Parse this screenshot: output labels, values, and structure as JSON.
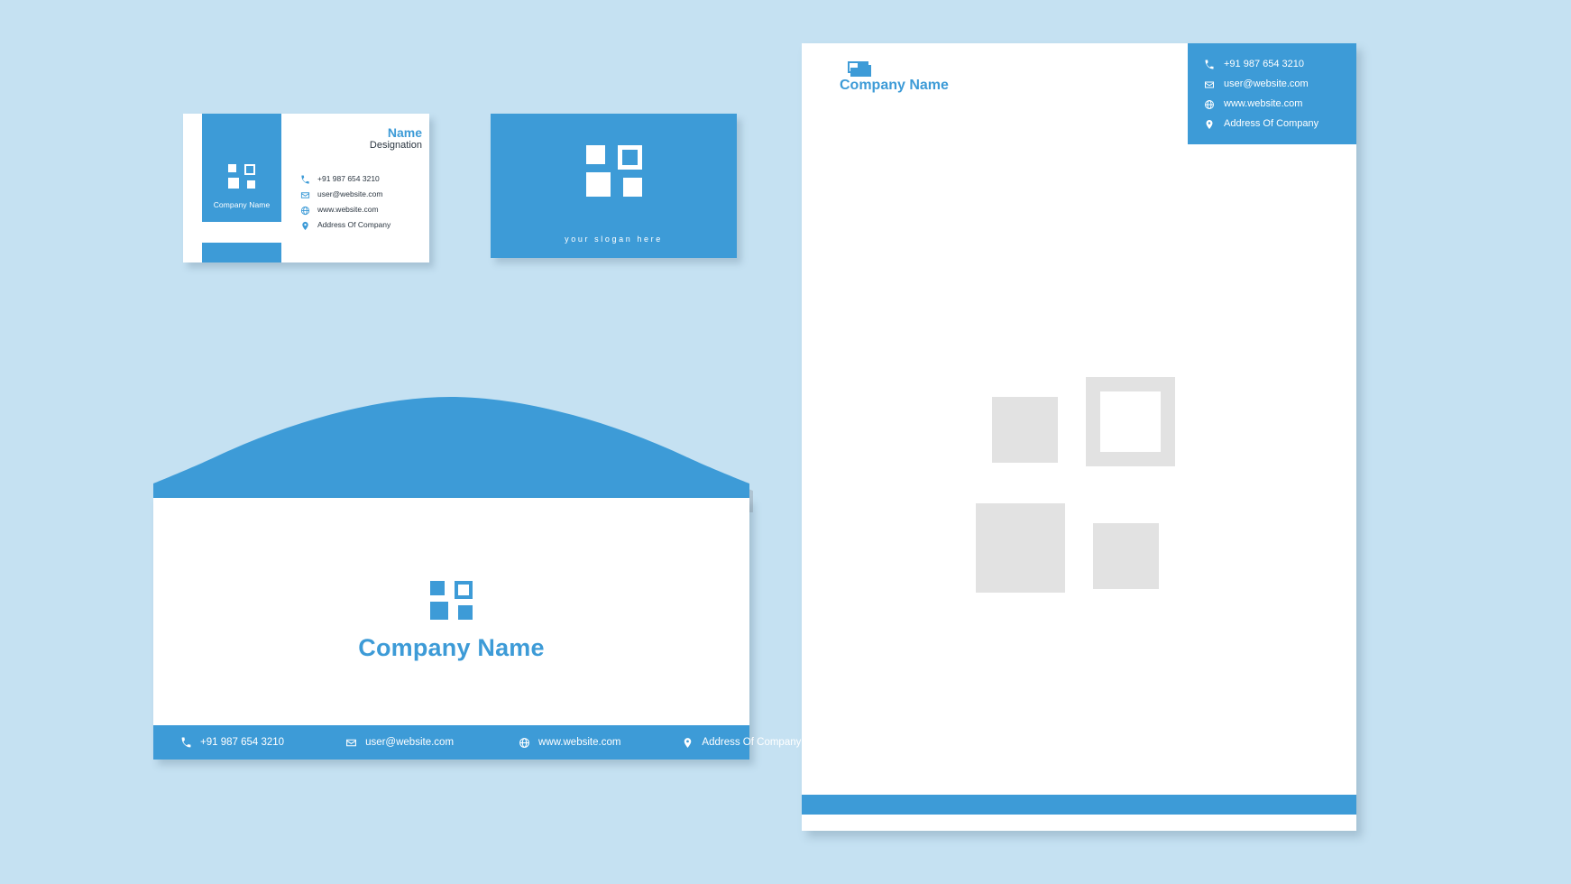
{
  "brand": {
    "primary_color": "#3d9bd7",
    "background_color": "#c5e1f2",
    "watermark_color": "#e2e2e2",
    "text_color": "#2b3641"
  },
  "company": {
    "name": "Company Name",
    "slogan": "your slogan here",
    "person_name": "Name",
    "designation": "Designation"
  },
  "contact": {
    "phone": "+91 987 654 3210",
    "email": "user@website.com",
    "website": "www.website.com",
    "address": "Address Of Company",
    "icons": {
      "phone": "phone-icon",
      "email": "envelope-icon",
      "website": "globe-icon",
      "address": "location-pin-icon"
    }
  },
  "business_card_front": {
    "company_name": "Company Name",
    "person_name": "Name",
    "designation": "Designation",
    "contact_lines": [
      {
        "icon": "phone-icon",
        "text": "+91 987 654 3210"
      },
      {
        "icon": "envelope-icon",
        "text": "user@website.com"
      },
      {
        "icon": "globe-icon",
        "text": "www.website.com"
      },
      {
        "icon": "location-pin-icon",
        "text": "Address Of Company"
      }
    ]
  },
  "business_card_back": {
    "slogan": "your slogan here"
  },
  "envelope": {
    "company_name": "Company Name",
    "footer_items": [
      {
        "icon": "phone-icon",
        "text": "+91 987 654 3210"
      },
      {
        "icon": "envelope-icon",
        "text": "user@website.com"
      },
      {
        "icon": "globe-icon",
        "text": "www.website.com"
      },
      {
        "icon": "location-pin-icon",
        "text": "Address Of Company"
      }
    ]
  },
  "letterhead": {
    "company_name": "Company Name",
    "contact_lines": [
      {
        "icon": "phone-icon",
        "text": "+91 987 654 3210"
      },
      {
        "icon": "envelope-icon",
        "text": "user@website.com"
      },
      {
        "icon": "globe-icon",
        "text": "www.website.com"
      },
      {
        "icon": "location-pin-icon",
        "text": "Address Of Company"
      }
    ]
  }
}
